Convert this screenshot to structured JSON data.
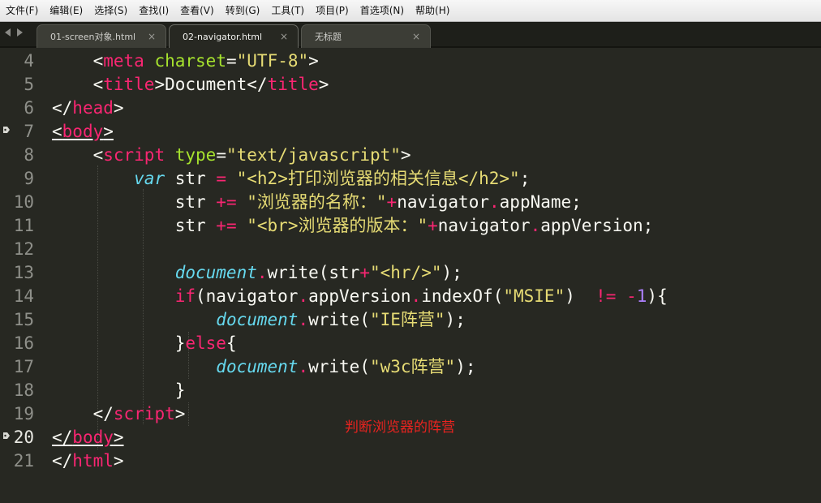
{
  "menu": [
    "文件(F)",
    "编辑(E)",
    "选择(S)",
    "查找(I)",
    "查看(V)",
    "转到(G)",
    "工具(T)",
    "项目(P)",
    "首选项(N)",
    "帮助(H)"
  ],
  "tabs": [
    {
      "label": "01-screen对象.html",
      "close": "×"
    },
    {
      "label": "02-navigator.html",
      "close": "×"
    },
    {
      "label": "无标题",
      "close": "×"
    }
  ],
  "line_numbers": [
    "4",
    "5",
    "6",
    "7",
    "8",
    "9",
    "10",
    "11",
    "12",
    "13",
    "14",
    "15",
    "16",
    "17",
    "18",
    "19",
    "20",
    "21"
  ],
  "code": {
    "l4": {
      "indent": "    ",
      "lt": "<",
      "tag": "meta",
      "attr": "charset",
      "eq": "=",
      "val": "\"UTF-8\"",
      "gt": ">"
    },
    "l5": {
      "indent": "    ",
      "lt": "<",
      "tag": "title",
      "gt": ">",
      "text": "Document",
      "lt2": "</",
      "tag2": "title",
      "gt2": ">"
    },
    "l6": {
      "lt": "</",
      "tag": "head",
      "gt": ">"
    },
    "l7": {
      "lt": "<",
      "tag": "body",
      "gt": ">"
    },
    "l8": {
      "indent": "    ",
      "lt": "<",
      "tag": "script",
      "attr": "type",
      "eq": "=",
      "val": "\"text/javascript\"",
      "gt": ">"
    },
    "l9": {
      "indent": "        ",
      "kw": "var",
      "sp": " str ",
      "op": "=",
      "sp2": " ",
      "str": "\"<h2>打印浏览器的相关信息</h2>\"",
      "end": ";"
    },
    "l10": {
      "indent": "            ",
      "a": "str ",
      "op": "+=",
      "sp": " ",
      "str": "\"浏览器的名称：\"",
      "op2": "+",
      "b": "navigator",
      "dot": ".",
      "c": "appName;"
    },
    "l11": {
      "indent": "            ",
      "a": "str ",
      "op": "+=",
      "sp": " ",
      "str": "\"<br>浏览器的版本：\"",
      "op2": "+",
      "b": "navigator",
      "dot": ".",
      "c": "appVersion;"
    },
    "l13": {
      "indent": "            ",
      "doc": "document",
      "dot": ".",
      "fn": "write(str",
      "op": "+",
      "str": "\"<hr/>\"",
      "end": ");"
    },
    "l14": {
      "indent": "            ",
      "kw": "if",
      "a": "(navigator",
      "dot": ".",
      "b": "appVersion",
      "dot2": ".",
      "c": "indexOf(",
      "str": "\"MSIE\"",
      "d": ")  ",
      "op": "!=",
      "sp": " ",
      "op2": "-",
      "num": "1",
      "e": "){"
    },
    "l15": {
      "indent": "                ",
      "doc": "document",
      "dot": ".",
      "fn": "write(",
      "str": "\"IE阵营\"",
      "end": ");"
    },
    "l16": {
      "indent": "            ",
      "a": "}",
      "kw": "else",
      "b": "{"
    },
    "l17": {
      "indent": "                ",
      "doc": "document",
      "dot": ".",
      "fn": "write(",
      "str": "\"w3c阵营\"",
      "end": ");"
    },
    "l18": {
      "indent": "            ",
      "a": "}"
    },
    "l19": {
      "indent": "    ",
      "lt": "</",
      "tag": "script",
      "gt": ">"
    },
    "l20": {
      "lt": "</",
      "tag": "body",
      "gt": ">"
    },
    "l21": {
      "lt": "</",
      "tag": "html",
      "gt": ">"
    }
  },
  "annotation": "判断浏览器的阵营",
  "colors": {
    "background": "#272822",
    "tag": "#f92672",
    "attribute": "#a6e22e",
    "string": "#e6db74",
    "keyword": "#66d9ef",
    "number": "#ae81ff",
    "annotation": "#e8231f"
  }
}
